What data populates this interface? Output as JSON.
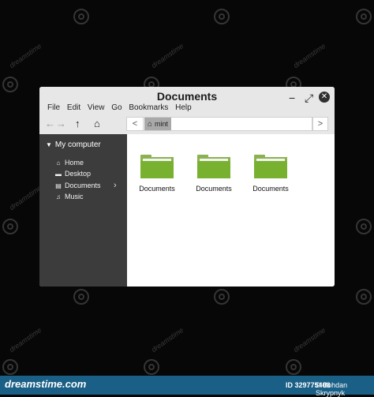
{
  "window": {
    "title": "Documents",
    "controls": {
      "minimize": "−",
      "maximize": "⤢",
      "close": "✕"
    }
  },
  "menubar": [
    "File",
    "Edit",
    "View",
    "Go",
    "Bookmarks",
    "Help"
  ],
  "toolbar": {
    "back": "←",
    "forward": "→",
    "up": "↑",
    "home": "⌂",
    "path_left": "<",
    "path_right": ">",
    "breadcrumb_icon": "home-icon",
    "breadcrumb": "mint"
  },
  "sidebar": {
    "header": "My computer",
    "items": [
      {
        "label": "Home",
        "icon": "home-icon"
      },
      {
        "label": "Desktop",
        "icon": "desktop-icon"
      },
      {
        "label": "Documents",
        "icon": "document-icon"
      },
      {
        "label": "Music",
        "icon": "music-icon"
      }
    ]
  },
  "content": {
    "items": [
      {
        "label": "Documents",
        "icon": "folder-icon"
      },
      {
        "label": "Documents",
        "icon": "folder-icon"
      },
      {
        "label": "Documents",
        "icon": "folder-icon"
      }
    ]
  },
  "watermark": {
    "text": "dreamstime"
  },
  "footer": {
    "site": "dreamstime.com",
    "image_id": "ID 329775408",
    "author": "© Bohdan Skrypnyk"
  },
  "colors": {
    "background": "#070707",
    "titlebar": "#e7e7e7",
    "sidebar": "#3c3c3c",
    "folder": "#78b12f",
    "footer": "#1a5f86"
  }
}
